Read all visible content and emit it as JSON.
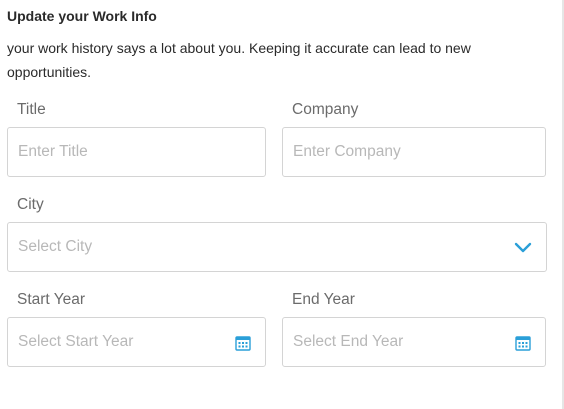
{
  "dialog": {
    "title": "Update your Work Info",
    "description": "your work history says a lot about you. Keeping it accurate can lead to new opportunities."
  },
  "fields": {
    "title": {
      "label": "Title",
      "placeholder": "Enter Title"
    },
    "company": {
      "label": "Company",
      "placeholder": "Enter Company"
    },
    "city": {
      "label": "City",
      "placeholder": "Select City"
    },
    "start_year": {
      "label": "Start Year",
      "placeholder": "Select Start Year"
    },
    "end_year": {
      "label": "End Year",
      "placeholder": "Select End Year"
    }
  },
  "icons": {
    "dropdown": "chevron-down-icon",
    "date_picker": "calendar-icon"
  },
  "colors": {
    "accent": "#2a9fd8",
    "border": "#d4d4d4",
    "label": "#6b6b6b",
    "placeholder": "#b8b8b8"
  }
}
